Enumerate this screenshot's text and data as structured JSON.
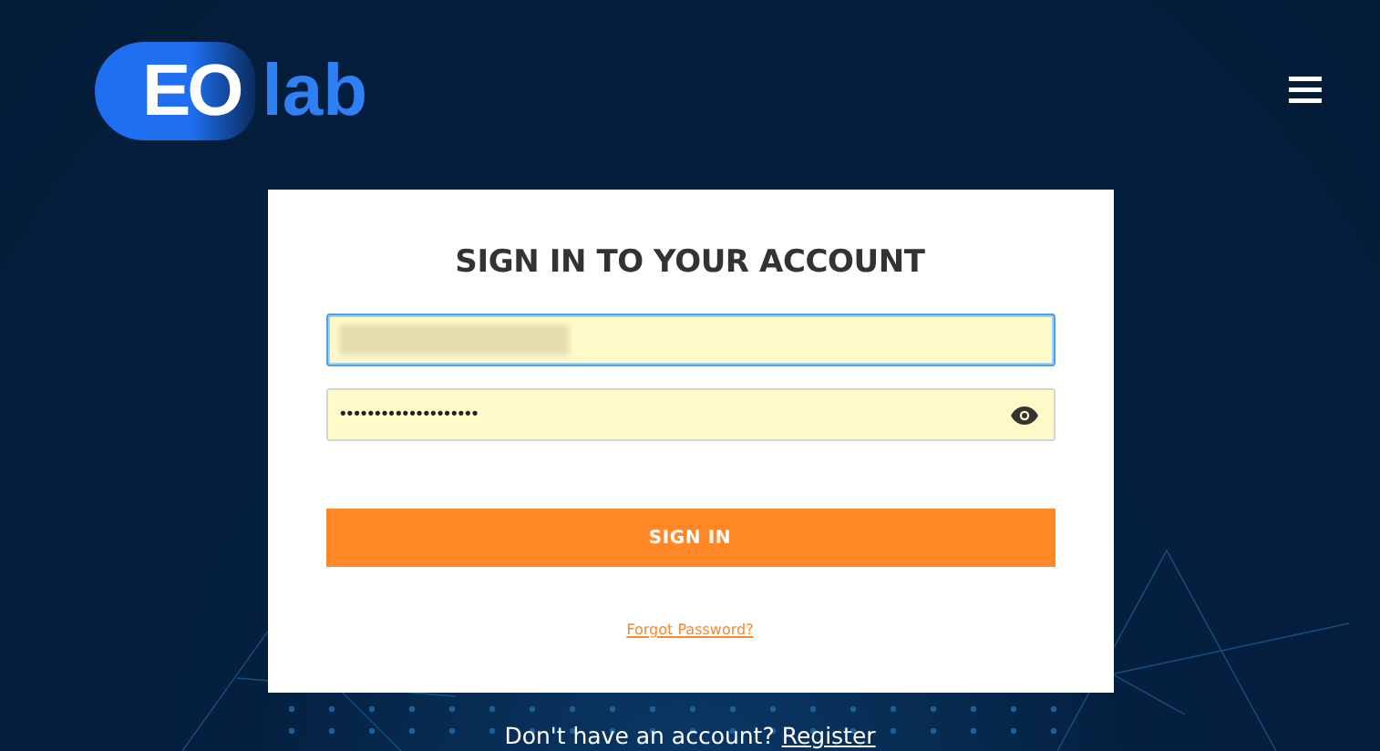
{
  "header": {
    "logo": {
      "mark": "EO",
      "word": "lab"
    }
  },
  "card": {
    "title": "SIGN IN TO YOUR ACCOUNT",
    "email": {
      "focused": true,
      "redacted": true
    },
    "password": {
      "value": "••••••••••••••••••••",
      "focused": false
    },
    "button": "SIGN IN",
    "forgot_link": "Forgot Password?"
  },
  "footer": {
    "text": "Don't have an account?",
    "link": "Register"
  }
}
